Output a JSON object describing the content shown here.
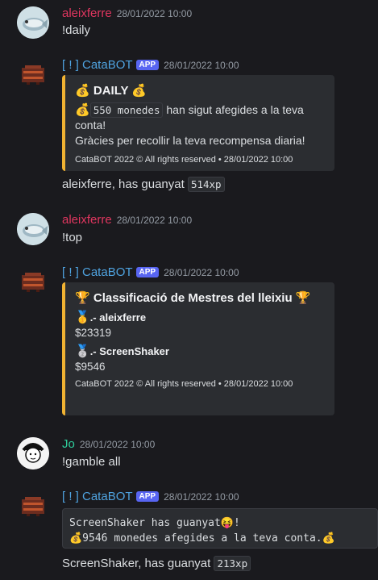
{
  "messages": [
    {
      "author": "aleixferre",
      "time": "28/01/2022 10:00",
      "content": "!daily"
    },
    {
      "author": "[ ! ] CataBOT",
      "tag": "APP",
      "time": "28/01/2022 10:00",
      "embed": {
        "title": "DAILY",
        "title_emoji": "💰",
        "desc_code": "550 monedes",
        "desc_emoji": "💰",
        "desc_rest": " han sigut afegides a la teva conta!",
        "desc_line2": "Gràcies per recollir la teva recompensa diaria!",
        "footer": "CataBOT 2022 © All rights reserved • 28/01/2022 10:00"
      },
      "after_text": "aleixferre, has guanyat ",
      "after_code": "514xp"
    },
    {
      "author": "aleixferre",
      "time": "28/01/2022 10:00",
      "content": "!top"
    },
    {
      "author": "[ ! ] CataBOT",
      "tag": "APP",
      "time": "28/01/2022 10:00",
      "embed": {
        "title": "Classificació de Mestres del lleixiu",
        "title_emoji": "🏆",
        "fields": [
          {
            "emoji": "🥇",
            "name": ".- aleixferre",
            "value": "$23319"
          },
          {
            "emoji": "🥈",
            "name": ".- ScreenShaker",
            "value": "$9546"
          }
        ],
        "footer": "CataBOT 2022 © All rights reserved • 28/01/2022 10:00"
      }
    },
    {
      "author": "Jo",
      "time": "28/01/2022 10:00",
      "content": "!gamble all"
    },
    {
      "author": "[ ! ] CataBOT",
      "tag": "APP",
      "time": "28/01/2022 10:00",
      "codeblock_line1": "ScreenShaker has guanyat😝!",
      "codeblock_line2": "💰9546 monedes afegides a la teva conta.💰",
      "after_text": "ScreenShaker, has guanyat ",
      "after_code": "213xp"
    }
  ],
  "colors": {
    "embed_accent": "#f0b232",
    "user_name": "#e0365f",
    "bot_name": "#4fa3e0",
    "jo_name": "#2ecc9a"
  },
  "icons": {
    "avatar_user": "fish-avatar",
    "avatar_bot": "pixel-creature-avatar",
    "avatar_jo": "cartoon-face-avatar"
  }
}
